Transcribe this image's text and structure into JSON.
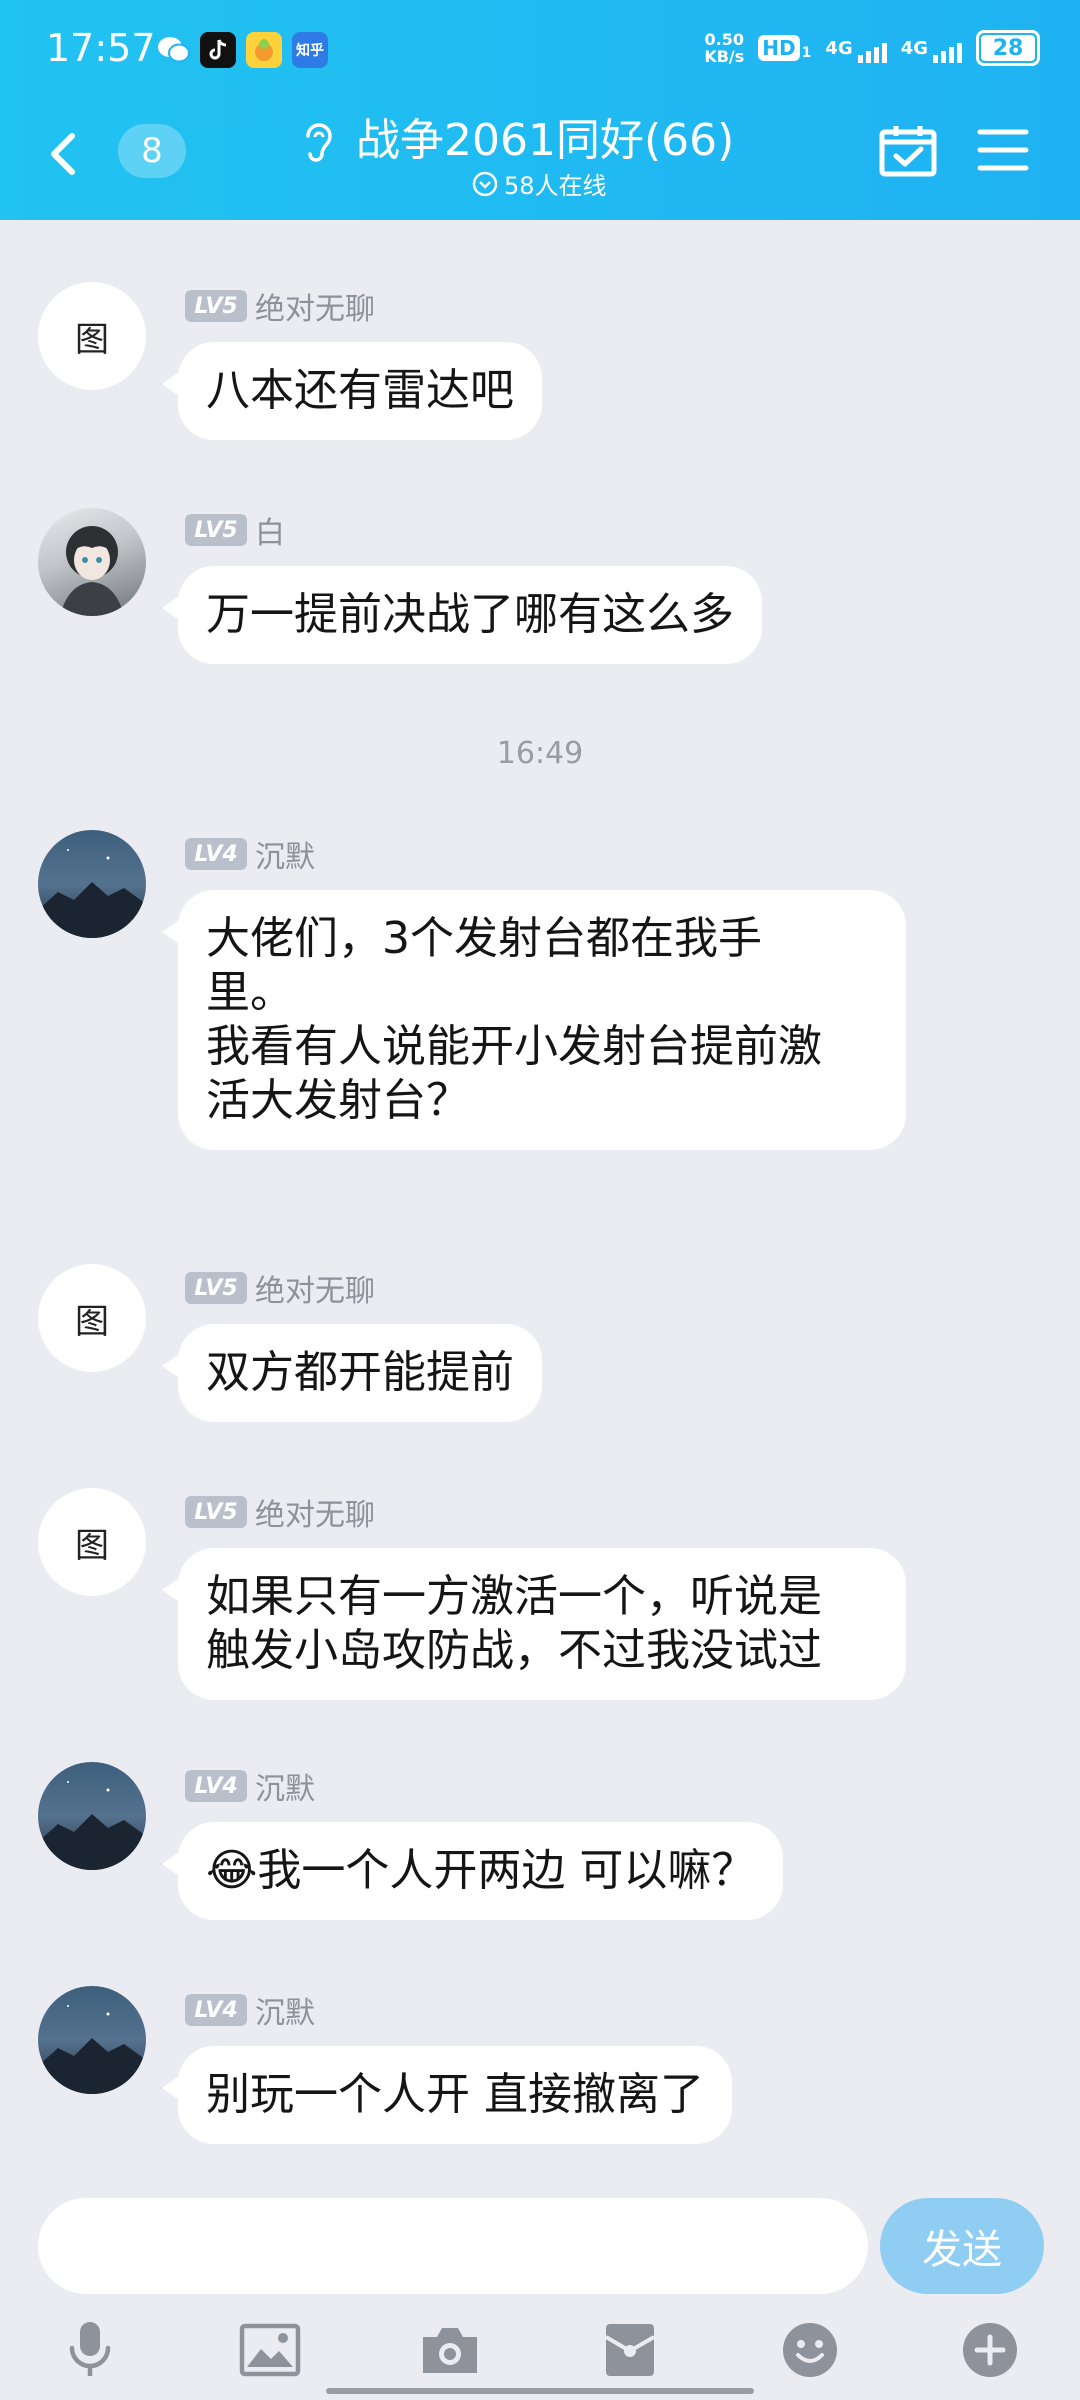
{
  "status_bar": {
    "time": "17:57",
    "net_speed_value": "0.50",
    "net_speed_unit": "KB/s",
    "hd": "HD",
    "hd_sub": "1",
    "net1": "4G",
    "net2": "4G",
    "battery": "28",
    "app_icons": [
      "wechat-icon",
      "tiktok-icon",
      "game-icon",
      "zhihu-icon"
    ],
    "zhihu_label": "知乎"
  },
  "header": {
    "unread_count": "8",
    "group_name": "战争2061同好(66)",
    "online": "58人在线",
    "accent": "#1FB2F2"
  },
  "messages": [
    {
      "type": "msg",
      "level": "LV5",
      "name": "绝对无聊",
      "avatar_text": "图",
      "lines": [
        "八本还有雷达吧"
      ]
    },
    {
      "type": "msg",
      "level": "LV5",
      "name": "白",
      "avatar_text": "",
      "lines": [
        "万一提前决战了哪有这么多"
      ]
    },
    {
      "type": "time",
      "text": "16:49"
    },
    {
      "type": "msg",
      "level": "LV4",
      "name": "沉默",
      "avatar_text": "",
      "lines": [
        "大佬们，3个发射台都在我手",
        "里。",
        "我看有人说能开小发射台提前激",
        "活大发射台？"
      ]
    },
    {
      "type": "msg",
      "level": "LV5",
      "name": "绝对无聊",
      "avatar_text": "图",
      "lines": [
        "双方都开能提前"
      ]
    },
    {
      "type": "msg",
      "level": "LV5",
      "name": "绝对无聊",
      "avatar_text": "图",
      "lines": [
        "如果只有一方激活一个，听说是",
        "触发小岛攻防战，不过我没试过"
      ]
    },
    {
      "type": "msg",
      "level": "LV4",
      "name": "沉默",
      "avatar_text": "",
      "lines": [
        "😂我一个人开两边 可以嘛？"
      ]
    },
    {
      "type": "msg",
      "level": "LV4",
      "name": "沉默",
      "avatar_text": "",
      "lines": [
        "别玩一个人开 直接撤离了"
      ]
    }
  ],
  "composer": {
    "placeholder": "",
    "send_label": "发送",
    "toolbar": [
      "microphone-icon",
      "image-icon",
      "camera-icon",
      "red-packet-icon",
      "emoji-icon",
      "plus-icon"
    ]
  }
}
